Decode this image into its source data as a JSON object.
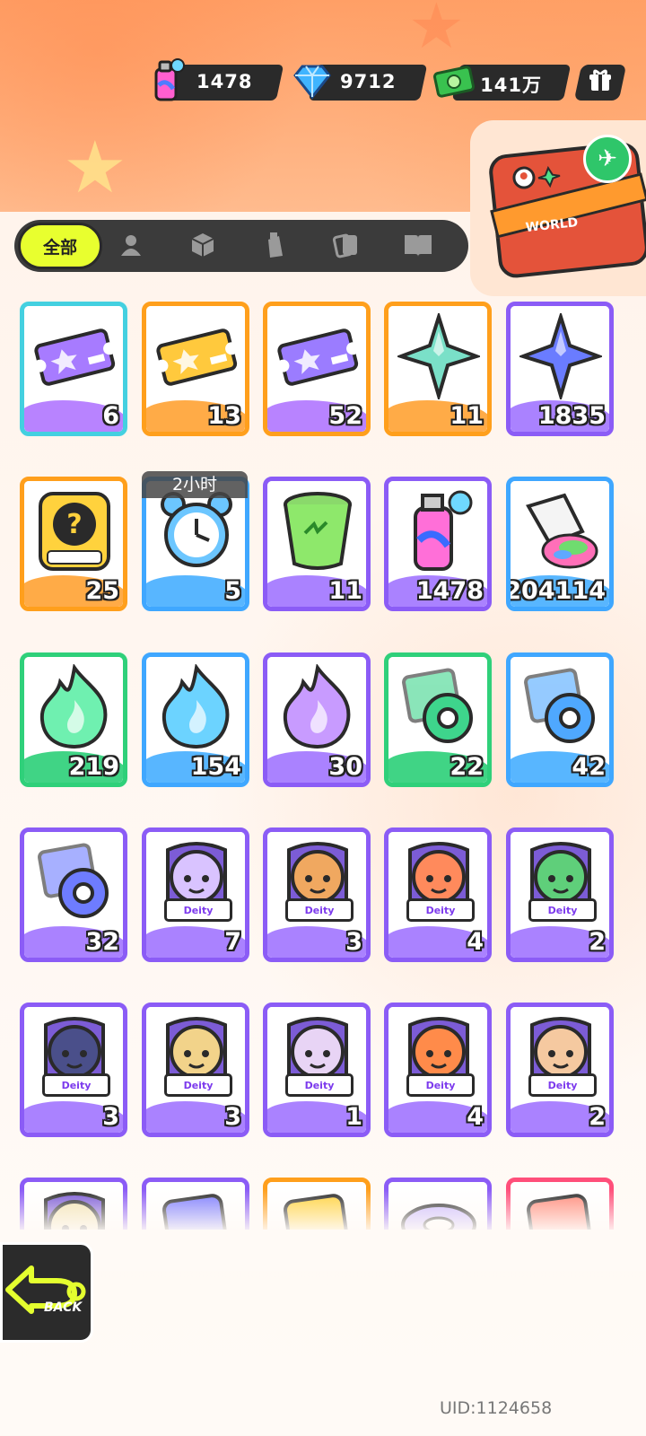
{
  "header": {
    "currencies": [
      {
        "name": "spray-currency",
        "value": "1478",
        "icon": "spray-can-icon"
      },
      {
        "name": "diamond-currency",
        "value": "9712",
        "icon": "diamond-icon"
      },
      {
        "name": "cash-currency",
        "value": "141万",
        "icon": "cash-icon"
      }
    ],
    "menu_icon": "gift-box-icon"
  },
  "world_button": {
    "label": "WORLD",
    "icon": "suitcase-icon"
  },
  "tabs": {
    "active_label": "全部",
    "icons": [
      "person-icon",
      "box-icon",
      "spray-tab-icon",
      "cards-icon",
      "book-icon"
    ]
  },
  "items": [
    {
      "name": "purple-ticket",
      "count": "6",
      "border": "#44d0e0",
      "wave": "#b47cff",
      "icon": "ticket-icon",
      "fill": "#a77bff"
    },
    {
      "name": "gold-ticket",
      "count": "13",
      "border": "#ff9f1c",
      "wave": "#ffa73d",
      "icon": "ticket-icon",
      "fill": "#ffc93d"
    },
    {
      "name": "violet-ticket",
      "count": "52",
      "border": "#ff9f1c",
      "wave": "#b47cff",
      "icon": "ticket-icon",
      "fill": "#9b7cff"
    },
    {
      "name": "rainbow-star-shard",
      "count": "11",
      "border": "#ff9f1c",
      "wave": "#ffa73d",
      "icon": "star-shard-icon",
      "fill": "#7ae0c8"
    },
    {
      "name": "blue-star-shard",
      "count": "1835",
      "border": "#8b5cf6",
      "wave": "#a57bff",
      "icon": "star-shard-icon",
      "fill": "#6a7cff"
    },
    {
      "name": "deity-mystery-card",
      "count": "25",
      "border": "#ff9f1c",
      "wave": "#ffa73d",
      "icon": "question-card-icon",
      "fill": "#ffd23d"
    },
    {
      "name": "alarm-clock",
      "count": "5",
      "border": "#3fa7ff",
      "wave": "#4fb2ff",
      "icon": "alarm-clock-icon",
      "fill": "#6cc6ff",
      "timer": "2小时"
    },
    {
      "name": "green-cup",
      "count": "11",
      "border": "#8b5cf6",
      "wave": "#a57bff",
      "icon": "cup-icon",
      "fill": "#8ee86b"
    },
    {
      "name": "spray-can",
      "count": "1478",
      "border": "#8b5cf6",
      "wave": "#a57bff",
      "icon": "spray-can-icon",
      "fill": "#ff6fd8"
    },
    {
      "name": "paint-tube",
      "count": "204114",
      "border": "#3fa7ff",
      "wave": "#4fb2ff",
      "icon": "paint-tube-icon",
      "fill": "#ff6fb8"
    },
    {
      "name": "green-flame",
      "count": "219",
      "border": "#2fd07a",
      "wave": "#36d27e",
      "icon": "flame-icon",
      "fill": "#6ff0b0"
    },
    {
      "name": "blue-flame",
      "count": "154",
      "border": "#3fa7ff",
      "wave": "#4fb2ff",
      "icon": "flame-icon",
      "fill": "#6cd3ff"
    },
    {
      "name": "purple-flame",
      "count": "30",
      "border": "#8b5cf6",
      "wave": "#a57bff",
      "icon": "flame-icon",
      "fill": "#c89bff"
    },
    {
      "name": "green-tape-roll",
      "count": "22",
      "border": "#2fd07a",
      "wave": "#36d27e",
      "icon": "tape-roll-icon",
      "fill": "#3ed58c"
    },
    {
      "name": "blue-tape-roll",
      "count": "42",
      "border": "#3fa7ff",
      "wave": "#4fb2ff",
      "icon": "tape-roll-icon",
      "fill": "#4fa8ff"
    },
    {
      "name": "purple-tape-roll",
      "count": "32",
      "border": "#8b5cf6",
      "wave": "#a57bff",
      "icon": "tape-roll-icon",
      "fill": "#6e7cff"
    },
    {
      "name": "deity-card-1",
      "count": "7",
      "border": "#8b5cf6",
      "wave": "#a57bff",
      "icon": "character-portrait-icon",
      "fill": "#d9c3ff",
      "deity": "Deity"
    },
    {
      "name": "deity-card-2",
      "count": "3",
      "border": "#8b5cf6",
      "wave": "#a57bff",
      "icon": "character-portrait-icon",
      "fill": "#f0a860",
      "deity": "Deity"
    },
    {
      "name": "deity-card-3",
      "count": "4",
      "border": "#8b5cf6",
      "wave": "#a57bff",
      "icon": "character-portrait-icon",
      "fill": "#ff8a5c",
      "deity": "Deity"
    },
    {
      "name": "deity-card-4",
      "count": "2",
      "border": "#8b5cf6",
      "wave": "#a57bff",
      "icon": "character-portrait-icon",
      "fill": "#5fcf7a",
      "deity": "Deity"
    },
    {
      "name": "deity-card-5",
      "count": "3",
      "border": "#8b5cf6",
      "wave": "#a57bff",
      "icon": "character-portrait-icon",
      "fill": "#4a4f8a",
      "deity": "Deity"
    },
    {
      "name": "deity-card-6",
      "count": "3",
      "border": "#8b5cf6",
      "wave": "#a57bff",
      "icon": "character-portrait-icon",
      "fill": "#f2d38a",
      "deity": "Deity"
    },
    {
      "name": "deity-card-7",
      "count": "1",
      "border": "#8b5cf6",
      "wave": "#a57bff",
      "icon": "character-portrait-icon",
      "fill": "#e8d4f5",
      "deity": "Deity"
    },
    {
      "name": "deity-card-8",
      "count": "4",
      "border": "#8b5cf6",
      "wave": "#a57bff",
      "icon": "character-portrait-icon",
      "fill": "#ff8b4a",
      "deity": "Deity"
    },
    {
      "name": "deity-card-9",
      "count": "2",
      "border": "#8b5cf6",
      "wave": "#a57bff",
      "icon": "character-portrait-icon",
      "fill": "#f5c9a0",
      "deity": "Deity"
    },
    {
      "name": "partial-item-1",
      "count": "",
      "border": "#8b5cf6",
      "wave": "#a57bff",
      "icon": "character-portrait-icon",
      "fill": "#f2e2b0"
    },
    {
      "name": "partial-item-2",
      "count": "",
      "border": "#8b5cf6",
      "wave": "#a57bff",
      "icon": "phone-card-icon",
      "fill": "#7c7cff"
    },
    {
      "name": "partial-item-3",
      "count": "",
      "border": "#ff9f1c",
      "wave": "#ffa73d",
      "icon": "phone-card-icon",
      "fill": "#ffd23d"
    },
    {
      "name": "partial-item-4",
      "count": "",
      "border": "#8b5cf6",
      "wave": "#a57bff",
      "icon": "disc-icon",
      "fill": "#c9b8ff"
    },
    {
      "name": "partial-item-5",
      "count": "",
      "border": "#ff4f7a",
      "wave": "#ff6a8e",
      "icon": "phone-card-icon",
      "fill": "#ff8a7a"
    }
  ],
  "back_button": {
    "label": "BACK",
    "icon": "back-arrow-icon"
  },
  "uid": "UID:1124658"
}
